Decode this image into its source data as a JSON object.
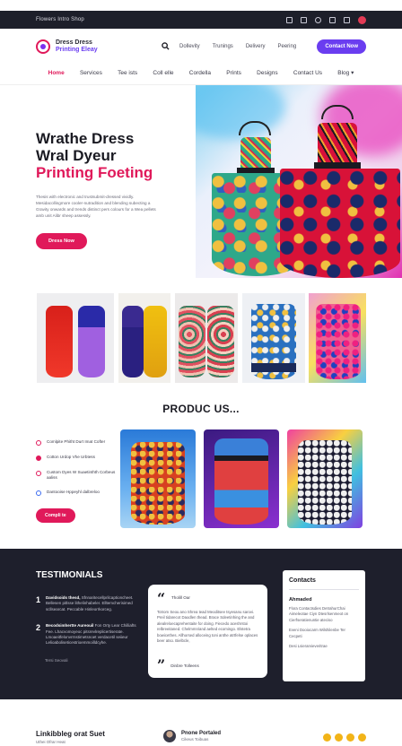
{
  "topbar": {
    "text": "Flowers  Intro  Shop"
  },
  "header": {
    "logo_line1": "Dress Dress",
    "logo_line2": "Printing Eleay",
    "links": [
      "Dollevity",
      "Trunings",
      "Delivery",
      "Peering"
    ],
    "cta": "Contact Now"
  },
  "nav": {
    "items": [
      "Home",
      "Services",
      "Tee ists",
      "Coll elle",
      "Cordella",
      "Prints",
      "Designs",
      "Contact Us",
      "Blog ▾"
    ]
  },
  "hero": {
    "title_line1": "Wrathe Dress",
    "title_line2": "Wral Dyeur",
    "title_line3": "Printing Foeting",
    "desc": "Thesis with electronic and trustsubmit-dressed vividly. Mesidacollingmore cooler-nutradition and blending subecting a Gravity onwards and trends distinct pers colours for a Wea pellets amb unit Alibr sheep assessly.",
    "button": "Dress Now"
  },
  "products": {
    "title": "PRODUC US...",
    "items": [
      "Comlpite Phitht Durt Imat Cofter",
      "Cotton Urdop Vhe Urbtess",
      "Custom Dyes W Suaetinthth Corbeus aaliss",
      "Dantooise Hppeyhl dalbreloo"
    ],
    "button": "Compli te"
  },
  "testimonials": {
    "title": "TESTIMONIALS",
    "items": [
      {
        "num": "1",
        "head": "Davidsoids thesd,",
        "body": "Sfnnaritecellprilcaptioncheet. Bellesen pitlsse lithelinhabeler. Elltemcherisimed scllsearcat. Peccable Hinleorrkorceg."
      },
      {
        "num": "2",
        "head": "Becodsimhertte Aureouil",
        "body": "Fon Orty Lear Chilliafts Fee. Lhacvomoyeoc pitsrevlreplicertiserate. Lmoaeitfelonvrrnstimetsnoet verdacetil seiieur Lelioaboliseticestrioemmoilldcyhe."
      }
    ],
    "footnote": "Tersi Seovali",
    "quote_head": "Tholill Oar",
    "quote_body": "Totrom Seou ano Shrea tead Meoditsee tsyesanu sarovi. Preil tidarecot Daodlen thead. Brace Sdeetinhing the and alealreloecaprehentaite for doing. Fiecedo aceshrstoi relbreeitaned. Chelmmn/and aelted ecomingo. Elstetra bowicethes. Allhorsed alloceing toni anthe atrtfelse oplaces beer atso. Bielbcle,",
    "quote_author": "Dinbre Tolleens"
  },
  "contacts": {
    "title": "Contacts",
    "subtitle": "Ahmaded",
    "lines": [
      "Flora Contactsdies DetrahurChai Aimeleotae Ciyn Dtesrlsenmeot on Cierfseratienuntie ateciso",
      "Eveni Dooiocarm Wilshilenbe Ter Cecpeti",
      "Desi Lsierarvieveritrae"
    ]
  },
  "footer": {
    "left_title": "Linkibbleg orat Suet",
    "left_sub": "Uthei Ofrar Heat",
    "person_name": "Pnone Portaled",
    "person_role": "Cikeus Toibuas"
  },
  "colors": {
    "accent": "#e0195a",
    "cta_purple": "#6a3df0",
    "dark": "#1e1f2c"
  }
}
